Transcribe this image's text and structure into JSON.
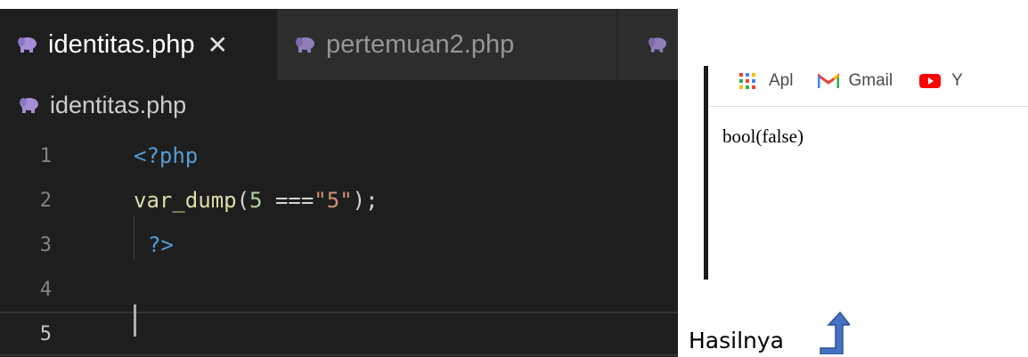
{
  "editor": {
    "tabs": [
      {
        "label": "identitas.php",
        "active": true,
        "close_glyph": "✕"
      },
      {
        "label": "pertemuan2.php",
        "active": false
      }
    ],
    "breadcrumb": "identitas.php",
    "lines": [
      {
        "number": "1"
      },
      {
        "number": "2"
      },
      {
        "number": "3"
      },
      {
        "number": "4"
      },
      {
        "number": "5"
      }
    ],
    "code": {
      "open_tag": "<?php",
      "fn_name": "var_dump",
      "paren_open": "(",
      "num": "5",
      "op": " ===",
      "str": "\"5\"",
      "paren_close": ");",
      "close_tag": "?>"
    },
    "colors": {
      "background": "#1e1e1e",
      "keyword": "#569cd6",
      "function": "#dcdcaa",
      "string": "#ce9178",
      "number": "#b5cea8",
      "php_icon": "#a48fd6"
    }
  },
  "browser": {
    "bookmarks": [
      {
        "label": "Apl",
        "icon": "apps-grid-icon"
      },
      {
        "label": "Gmail",
        "icon": "gmail-icon"
      },
      {
        "label": "Y",
        "icon": "youtube-icon"
      }
    ],
    "output": "bool(false)"
  },
  "caption": "Hasilnya",
  "arrow_icon": "arrow-up-icon"
}
